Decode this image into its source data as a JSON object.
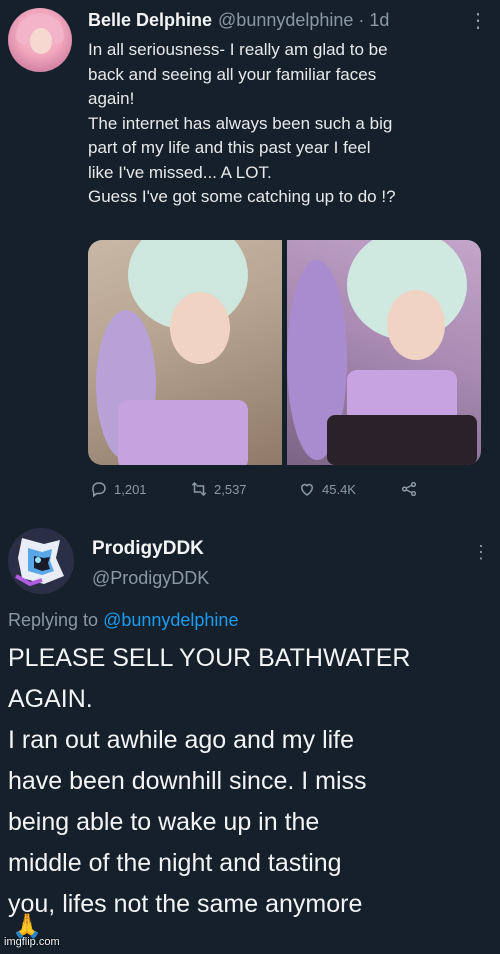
{
  "tweet1": {
    "author_name": "Belle Delphine",
    "author_handle": "@bunnydelphine · 1d",
    "more_label": "⋮",
    "text_lines": [
      "In all seriousness- I really am glad to be",
      "back and seeing all your familiar faces",
      "again!",
      "The internet has always been such a big",
      "part of my life and this past year I feel",
      "like I've missed... A LOT.",
      "Guess I've got some catching up to do !?"
    ],
    "replies": "1,201",
    "retweets": "2,537",
    "likes": "45.4K",
    "icons": [
      "reply-icon",
      "retweet-icon",
      "like-icon",
      "share-icon"
    ]
  },
  "tweet2": {
    "author_name": "ProdigyDDK",
    "author_handle": "@ProdigyDDK",
    "more_label": "⋮",
    "replying_prefix": "Replying to",
    "replying_mention": "@bunnydelphine",
    "text_lines": [
      "PLEASE SELL YOUR BATHWATER",
      "AGAIN.",
      "I ran out awhile ago and my life",
      "have been downhill since. I miss",
      "being able to wake up in the",
      "middle of the night and tasting",
      "you, lifes not the same anymore"
    ],
    "emoji": "🙏"
  },
  "watermark": "imgflip.com",
  "colors": {
    "background": "#15202b",
    "muted": "#8b98a5",
    "link": "#1d9bf0"
  }
}
